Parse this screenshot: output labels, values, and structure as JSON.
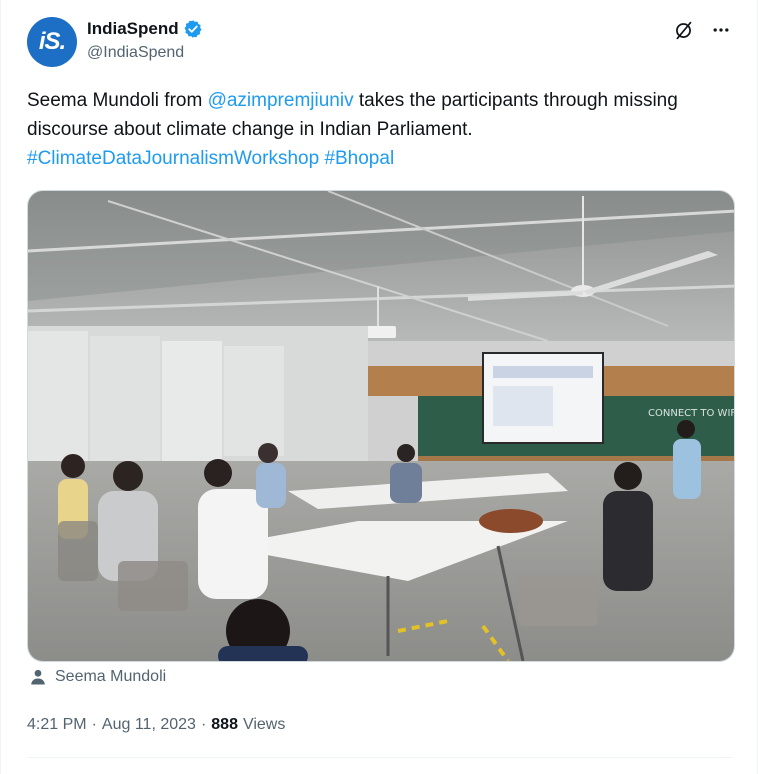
{
  "author": {
    "display_name": "IndiaSpend",
    "handle": "@IndiaSpend",
    "avatar_text": "iS.",
    "verified": true,
    "brand_color": "#1c6fc4"
  },
  "tweet": {
    "text_part1": "Seema Mundoli from ",
    "mention": "@azimpremjiuniv",
    "text_part2": " takes the participants through missing discourse about climate change in Indian Parliament.",
    "hashtag1": "#ClimateDataJournalismWorkshop",
    "hashtag2": "#Bhopal"
  },
  "media": {
    "tagged_person": "Seema Mundoli",
    "board_text": "CONNECT TO WIFI"
  },
  "meta": {
    "time": "4:21 PM",
    "separator": "·",
    "date": "Aug 11, 2023",
    "view_count": "888",
    "views_label": "Views"
  },
  "colors": {
    "link": "#1d9bf0",
    "text": "#0f1419",
    "muted": "#536471"
  },
  "icons": {
    "grok": "grok-icon",
    "more": "more-icon",
    "tag": "person-icon"
  }
}
